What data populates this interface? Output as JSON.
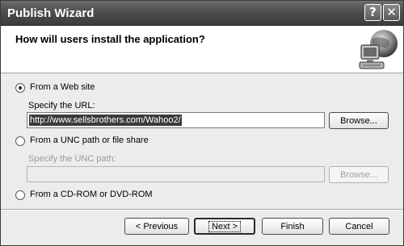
{
  "window": {
    "title": "Publish Wizard"
  },
  "titlebar": {
    "help_glyph": "?",
    "close_glyph": "✕"
  },
  "header": {
    "title": "How will users install the application?",
    "icon": "network-computer-icon"
  },
  "options": {
    "web": {
      "label": "From a Web site",
      "selected": true
    },
    "url_label": "Specify the URL:",
    "url_value": "http://www.sellsbrothers.com/Wahoo2/",
    "browse1_label": "Browse...",
    "unc": {
      "label": "From a UNC path or file share",
      "selected": false
    },
    "unc_label": "Specify the UNC path:",
    "unc_value": "",
    "browse2_label": "Browse...",
    "cd": {
      "label": "From a CD-ROM or DVD-ROM",
      "selected": false
    }
  },
  "footer": {
    "previous_label": "< Previous",
    "next_label": "Next >",
    "finish_label": "Finish",
    "cancel_label": "Cancel"
  }
}
